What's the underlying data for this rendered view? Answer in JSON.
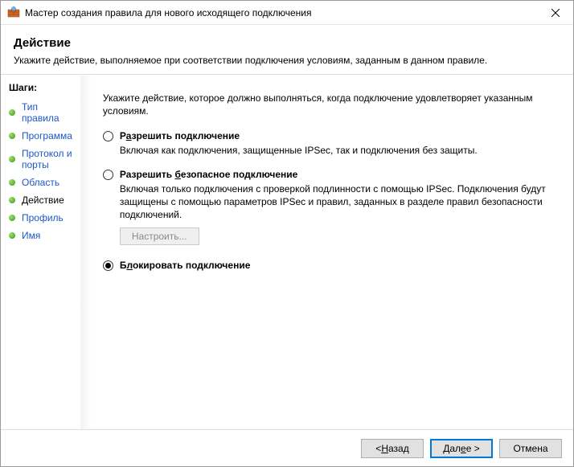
{
  "window": {
    "title": "Мастер создания правила для нового исходящего подключения"
  },
  "header": {
    "title": "Действие",
    "subtitle": "Укажите действие, выполняемое при соответствии подключения условиям, заданным в данном правиле."
  },
  "sidebar": {
    "steps_label": "Шаги:",
    "steps": [
      {
        "label": "Тип правила",
        "current": false
      },
      {
        "label": "Программа",
        "current": false
      },
      {
        "label": "Протокол и порты",
        "current": false
      },
      {
        "label": "Область",
        "current": false
      },
      {
        "label": "Действие",
        "current": true
      },
      {
        "label": "Профиль",
        "current": false
      },
      {
        "label": "Имя",
        "current": false
      }
    ]
  },
  "main": {
    "intro": "Укажите действие, которое должно выполняться, когда подключение удовлетворяет указанным условиям.",
    "options": {
      "allow": {
        "title_pre": "Р",
        "title_access": "а",
        "title_post": "зрешить подключение",
        "desc": "Включая как подключения, защищенные IPSec, так и подключения без защиты.",
        "checked": false
      },
      "allow_secure": {
        "title_pre": "Разрешить ",
        "title_access": "б",
        "title_post": "езопасное подключение",
        "desc": "Включая только подключения с проверкой подлинности с помощью IPSec. Подключения будут защищены с помощью параметров IPSec и правил, заданных в разделе правил безопасности подключений.",
        "customize_label": "Настроить...",
        "checked": false
      },
      "block": {
        "title_pre": "Б",
        "title_access": "л",
        "title_post": "окировать подключение",
        "checked": true
      }
    }
  },
  "footer": {
    "back_pre": "< ",
    "back_access": "Н",
    "back_post": "азад",
    "next_pre": "Дал",
    "next_access": "е",
    "next_post": "е >",
    "cancel": "Отмена"
  }
}
